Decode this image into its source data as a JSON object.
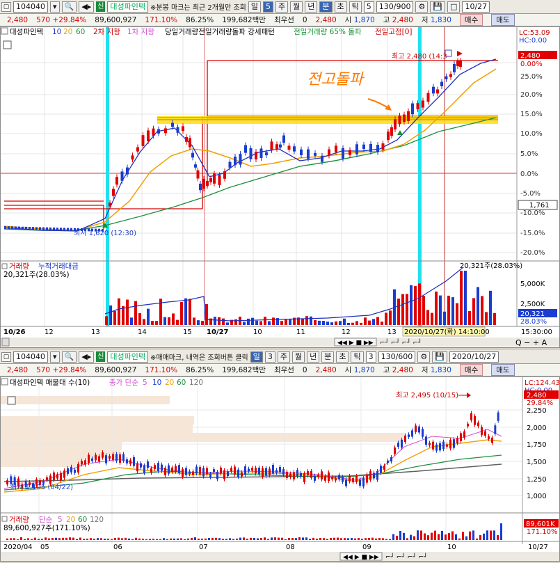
{
  "top": {
    "code": "104040",
    "sin": "신",
    "name": "대성파인텍",
    "notice": "※분봉 마크는 최근 2개월만 조회",
    "period": "일",
    "period_num": "5",
    "ranges": [
      "주",
      "월",
      "년",
      "분",
      "초",
      "틱"
    ],
    "tick_num": "5",
    "count": "130/900",
    "date": "10/27",
    "info": {
      "price": "2,480",
      "change": "570",
      "pct": "+29.84%",
      "volume": "89,600,927",
      "vol_pct": "171.10%",
      "ratio": "86.25%",
      "amount": "199,682백만",
      "best": "최우선",
      "best_qty": "0",
      "ask": "2,480",
      "open_label": "시",
      "open": "1,870",
      "high_label": "고",
      "high": "2,480",
      "low_label": "저",
      "low": "1,830",
      "buy": "매수",
      "sell": "매도"
    },
    "legend": {
      "title": "대성파인텍",
      "ma1": "10",
      "ma2": "20",
      "ma3": "60",
      "items": [
        "2차 저항",
        "1차 저항",
        "당일거래량전일거래량돌파 강세패턴",
        "전일거래량 65% 돌파",
        "전일고점[0]"
      ]
    },
    "corner": [
      "LC:53.09",
      "HC:0.00"
    ],
    "price_tag": "2,480",
    "pct_tag": "0.00%",
    "right_axis": [
      "25.0%",
      "20.0%",
      "15.0%",
      "10.0%",
      "5.0%",
      "0.0%",
      "-5.0%",
      "-10.0%",
      "-15.0%",
      "-20.0%"
    ],
    "level_tag": "1,761",
    "annot_high": "최고 2,480 (14:3",
    "annot_low": "최저 1,620 (12:30)",
    "handwriting": "전고돌파",
    "vol_legend": [
      "거래량",
      "누적거래대금"
    ],
    "vol_value": "20,321주(28.03%)",
    "vol_peak": "20,321주(28.03%)",
    "vol_axis": [
      "5,000K",
      "2,500K"
    ],
    "vol_tag": "20,321",
    "vol_tag2": "28.03%",
    "x_labels": [
      "10/26",
      "12",
      "13",
      "14",
      "15",
      "10/27",
      "10",
      "11",
      "12",
      "13",
      "14"
    ],
    "cursor_time": "2020/10/27(화) 14:10:00",
    "end_time": "15:30:00",
    "zoom": [
      "Q",
      "−",
      "+",
      "A"
    ]
  },
  "bottom": {
    "code": "104040",
    "sin": "신",
    "name": "대성파인텍",
    "notice": "※매매마크, 내역은 조회버튼 클릭",
    "period": "일",
    "period_num": "3",
    "ranges": [
      "주",
      "월",
      "년",
      "분",
      "초",
      "틱"
    ],
    "tick_num": "3",
    "count": "130/600",
    "date": "2020/10/27",
    "info": {
      "price": "2,480",
      "change": "570",
      "pct": "+29.84%",
      "volume": "89,600,927",
      "vol_pct": "171.10%",
      "ratio": "86.25%",
      "amount": "199,682백만",
      "best": "최우선",
      "best_qty": "0",
      "ask": "2,480",
      "open_label": "시",
      "open": "1,870",
      "high_label": "고",
      "high": "2,480",
      "low_label": "저",
      "low": "1,830",
      "buy": "매수",
      "sell": "매도"
    },
    "legend": {
      "title": "대성파인텍 매물대 수(10)",
      "ma_label": "종가 단순",
      "ma": [
        "5",
        "10",
        "20",
        "60",
        "120"
      ]
    },
    "corner": [
      "LC:124.43",
      "HC:0.00"
    ],
    "price_tag": "2,480",
    "pct_tag": "29.84%",
    "right_axis": [
      "2,250",
      "2,000",
      "1,750",
      "1,500",
      "1,250",
      "1,000"
    ],
    "annot_high": "최고 2,495 (10/15)",
    "annot_low": "최저 1,105 (04/22)",
    "vol_legend": [
      "거래량",
      "단순",
      "5",
      "20",
      "60",
      "120"
    ],
    "vol_value": "89,600,927주(171.10%)",
    "vol_tag": "89,601K",
    "vol_tag2": "171.10%",
    "x_labels": [
      "2020/04",
      "05",
      "06",
      "07",
      "08",
      "09",
      "10"
    ],
    "end_label": "10/27"
  },
  "colors": {
    "up": "#e00000",
    "down": "#1a3cd0",
    "ma_yellow": "#f0a000",
    "ma_blue": "#2030c0",
    "ma_green": "#209040",
    "cyan": "#20e0f0",
    "band": "#ffe000",
    "handwriting": "#ff7a00"
  }
}
